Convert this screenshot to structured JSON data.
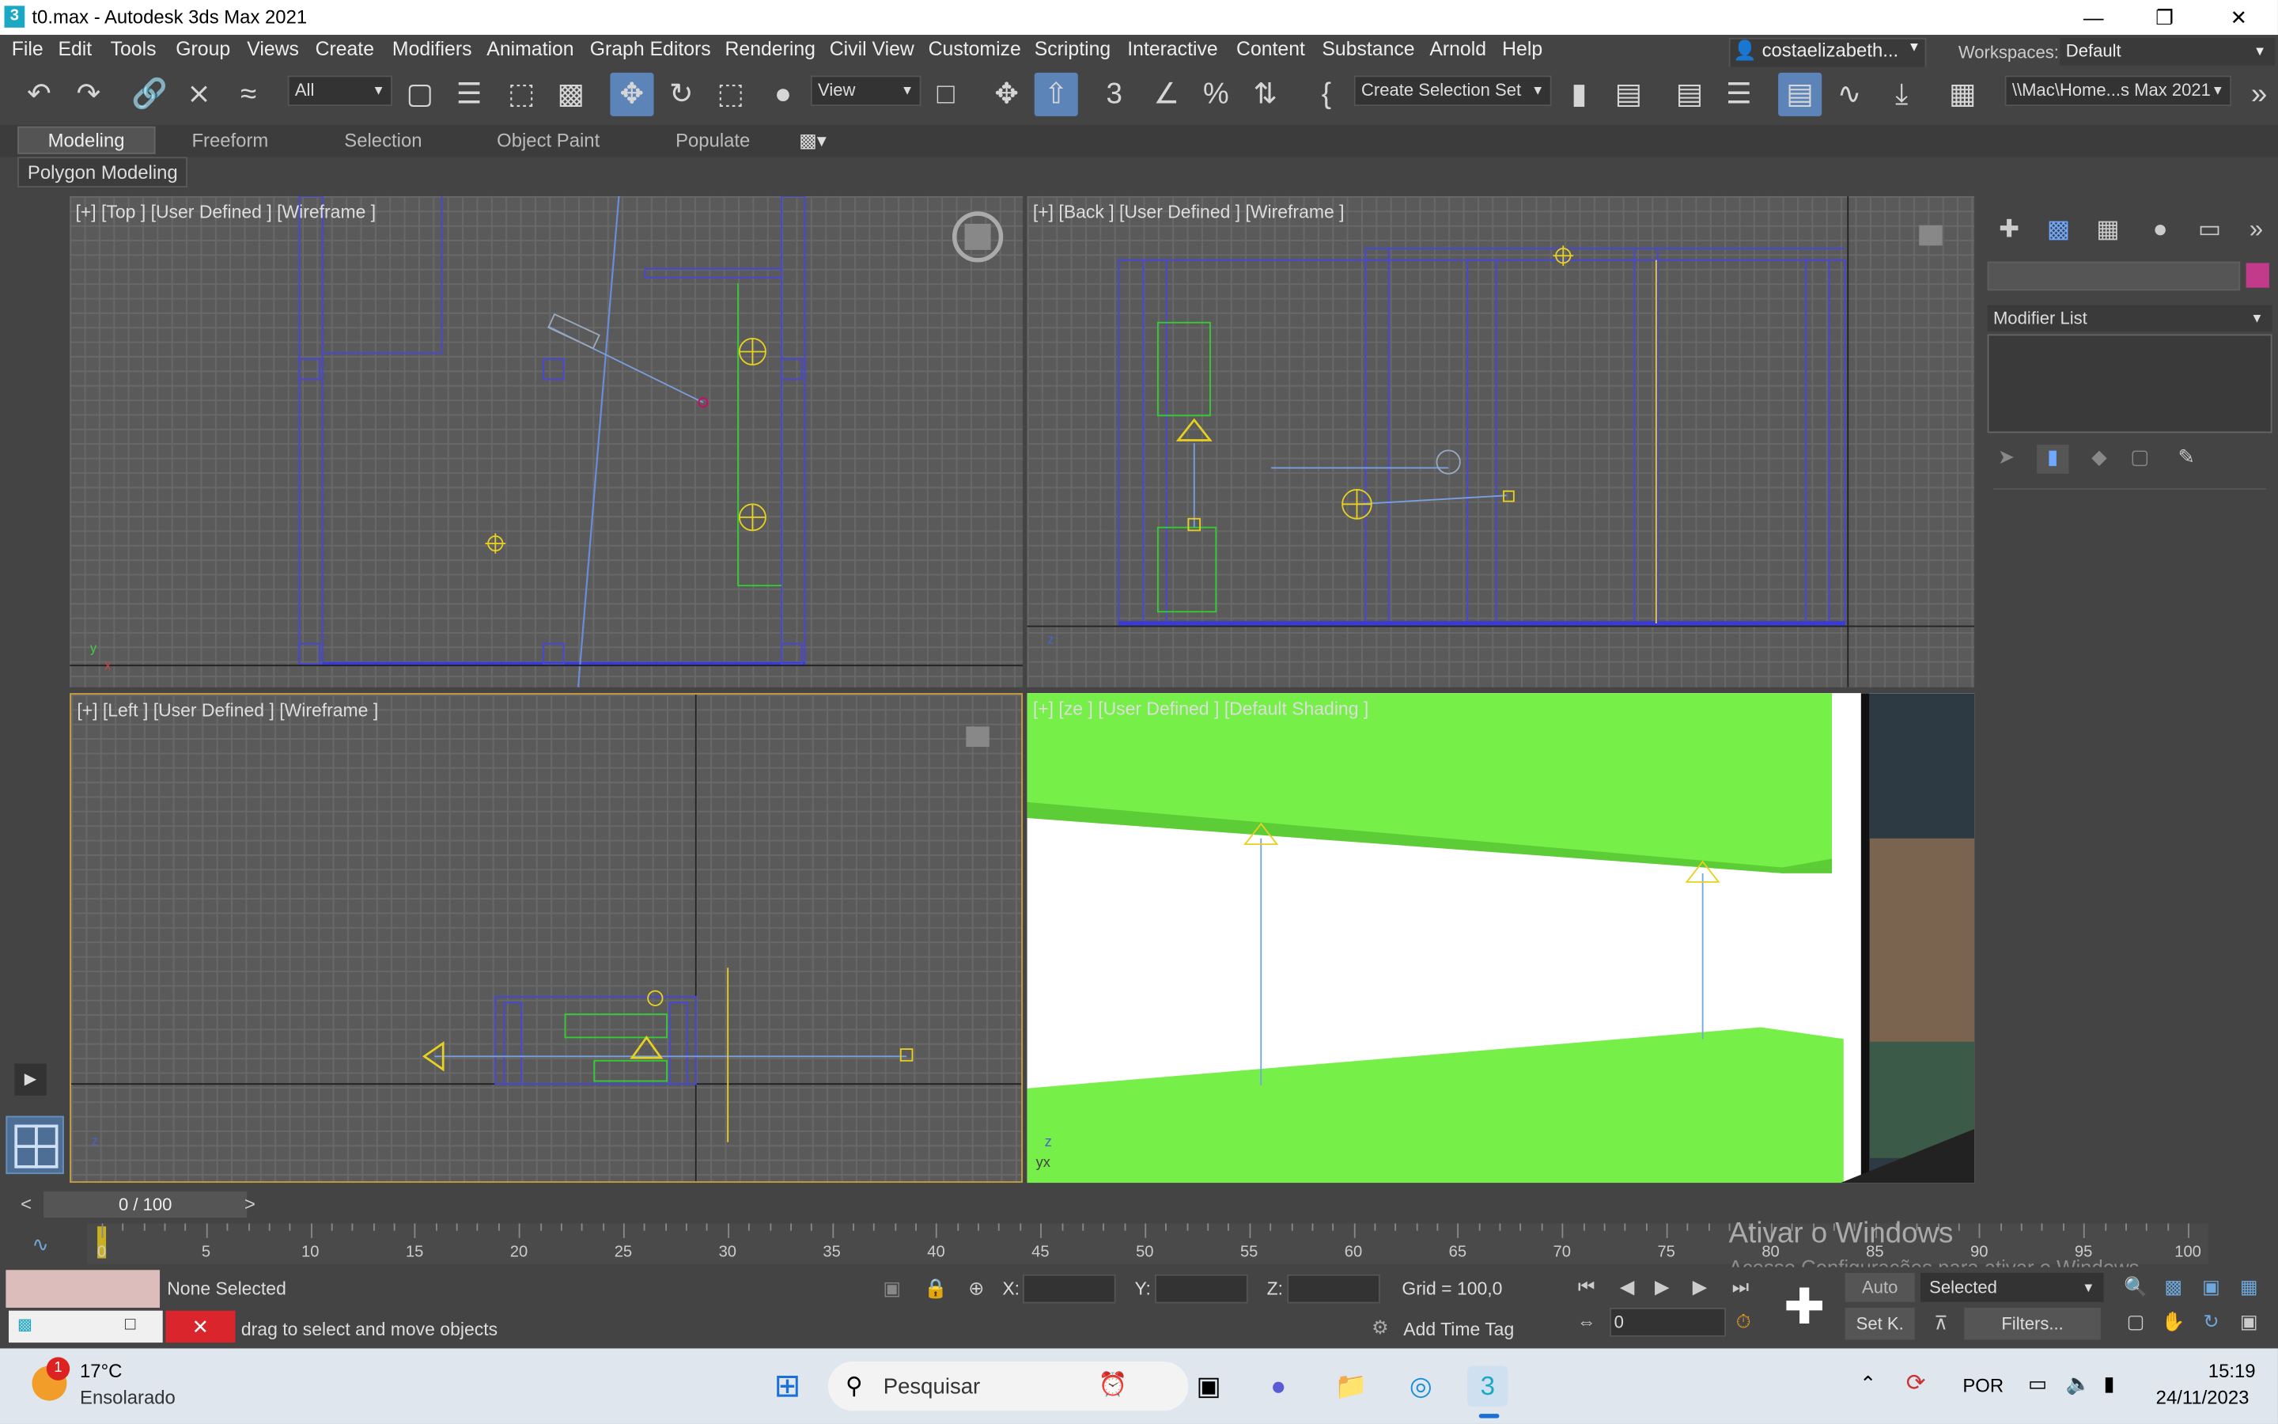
{
  "window": {
    "title": "t0.max - Autodesk 3ds Max 2021",
    "logo": "3",
    "minimize": "—",
    "restore": "❐",
    "close": "✕"
  },
  "menu": [
    {
      "label": "File"
    },
    {
      "label": "Edit"
    },
    {
      "label": "Tools"
    },
    {
      "label": "Group"
    },
    {
      "label": "Views"
    },
    {
      "label": "Create"
    },
    {
      "label": "Modifiers"
    },
    {
      "label": "Animation"
    },
    {
      "label": "Graph Editors"
    },
    {
      "label": "Rendering"
    },
    {
      "label": "Civil View"
    },
    {
      "label": "Customize"
    },
    {
      "label": "Scripting"
    },
    {
      "label": "Interactive"
    },
    {
      "label": "Content"
    },
    {
      "label": "Substance"
    },
    {
      "label": "Arnold"
    },
    {
      "label": "Help"
    }
  ],
  "user": {
    "name": "costaelizabeth..."
  },
  "workspaces": {
    "label": "Workspaces:",
    "value": "Default"
  },
  "toolbar": {
    "filter": "All",
    "ref_coord": "View",
    "selection_set": "Create Selection Set",
    "project_path": "\\\\Mac\\Home...s Max 2021"
  },
  "ribbon": {
    "tabs": [
      "Modeling",
      "Freeform",
      "Selection",
      "Object Paint",
      "Populate"
    ],
    "active": "Modeling",
    "polygon_modeling": "Polygon Modeling"
  },
  "viewports": {
    "top": "[+] [Top ] [User Defined ] [Wireframe ]",
    "back": "[+] [Back ] [User Defined ] [Wireframe ]",
    "left": "[+] [Left ] [User Defined ] [Wireframe ]",
    "persp": "[+] [ze ] [User Defined ] [Default Shading ]"
  },
  "command_panel": {
    "modifier_list": "Modifier List"
  },
  "timeline": {
    "frame": "0 / 100",
    "prev": "<",
    "next": ">",
    "ticks": [
      "0",
      "5",
      "10",
      "15",
      "20",
      "25",
      "30",
      "35",
      "40",
      "45",
      "50",
      "55",
      "60",
      "65",
      "70",
      "75",
      "80",
      "85",
      "90",
      "95",
      "100"
    ]
  },
  "status": {
    "selection": "None Selected",
    "prompt": "drag to select and move objects",
    "x_label": "X:",
    "y_label": "Y:",
    "z_label": "Z:",
    "grid": "Grid = 100,0",
    "add_time_tag": "Add Time Tag",
    "auto": "Auto",
    "set_k": "Set K.",
    "selected": "Selected",
    "filters": "Filters...",
    "frame_field": "0"
  },
  "watermark": {
    "title": "Ativar o Windows",
    "subtitle": "Acesse Configurações para ativar o Windows"
  },
  "taskbar": {
    "temp": "17°C",
    "weather": "Ensolarado",
    "badge": "1",
    "search": "Pesquisar",
    "lang": "POR",
    "time": "15:19",
    "date": "24/11/2023"
  },
  "colors": {
    "accent": "#5d84b8",
    "grass": "#76ef48",
    "viewport_bg": "#5a5a5a",
    "color_swatch": "#c23a8a"
  }
}
